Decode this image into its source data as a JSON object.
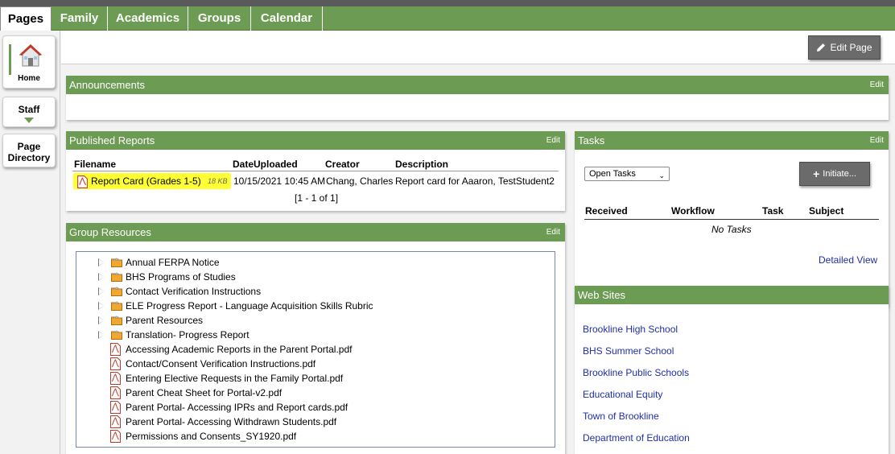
{
  "tabs": [
    {
      "label": "Pages",
      "active": true
    },
    {
      "label": "Family",
      "active": false
    },
    {
      "label": "Academics",
      "active": false
    },
    {
      "label": "Groups",
      "active": false
    },
    {
      "label": "Calendar",
      "active": false
    }
  ],
  "leftnav": {
    "home_label": "Home",
    "staff_label": "Staff",
    "page_directory_line1": "Page",
    "page_directory_line2": "Directory"
  },
  "toolbar": {
    "edit_page_label": "Edit Page"
  },
  "announcements": {
    "title": "Announcements",
    "edit_label": "Edit"
  },
  "published_reports": {
    "title": "Published Reports",
    "edit_label": "Edit",
    "columns": [
      "Filename",
      "DateUploaded",
      "Creator",
      "Description"
    ],
    "rows": [
      {
        "filename": "Report Card (Grades 1-5)",
        "size": "18 KB",
        "date_uploaded": "10/15/2021 10:45 AM",
        "creator": "Chang, Charles",
        "description": "Report card for Aaaron, TestStudent2"
      }
    ],
    "pagination": "[1 - 1 of 1]"
  },
  "group_resources": {
    "title": "Group Resources",
    "edit_label": "Edit",
    "folders": [
      "Annual FERPA Notice",
      "BHS Programs of Studies",
      "Contact Verification Instructions",
      "ELE Progress Report - Language Acquisition Skills Rubric",
      "Parent Resources",
      "Translation- Progress Report"
    ],
    "files": [
      "Accessing Academic Reports in the Parent Portal.pdf",
      "Contact/Consent Verification Instructions.pdf",
      "Entering Elective Requests in the Family Portal.pdf",
      "Parent Cheat Sheet for Portal-v2.pdf",
      "Parent Portal- Accessing IPRs and Report cards.pdf",
      "Parent Portal- Accessing Withdrawn Students.pdf",
      "Permissions and Consents_SY1920.pdf"
    ]
  },
  "tasks": {
    "title": "Tasks",
    "edit_label": "Edit",
    "filter_value": "Open Tasks",
    "initiate_label": "Initiate...",
    "columns": [
      "Received",
      "Workflow",
      "Task",
      "Subject"
    ],
    "empty_text": "No Tasks",
    "detailed_view_label": "Detailed View"
  },
  "web_sites": {
    "title": "Web Sites",
    "links": [
      "Brookline High School",
      "BHS Summer School",
      "Brookline Public Schools",
      "Educational Equity",
      "Town of Brookline",
      "Department of Education"
    ]
  },
  "colors": {
    "header_green": "#6c9b53",
    "highlight_yellow": "#ffff33",
    "link_blue": "#1f2fa8",
    "button_gray": "#6b6b6b"
  }
}
